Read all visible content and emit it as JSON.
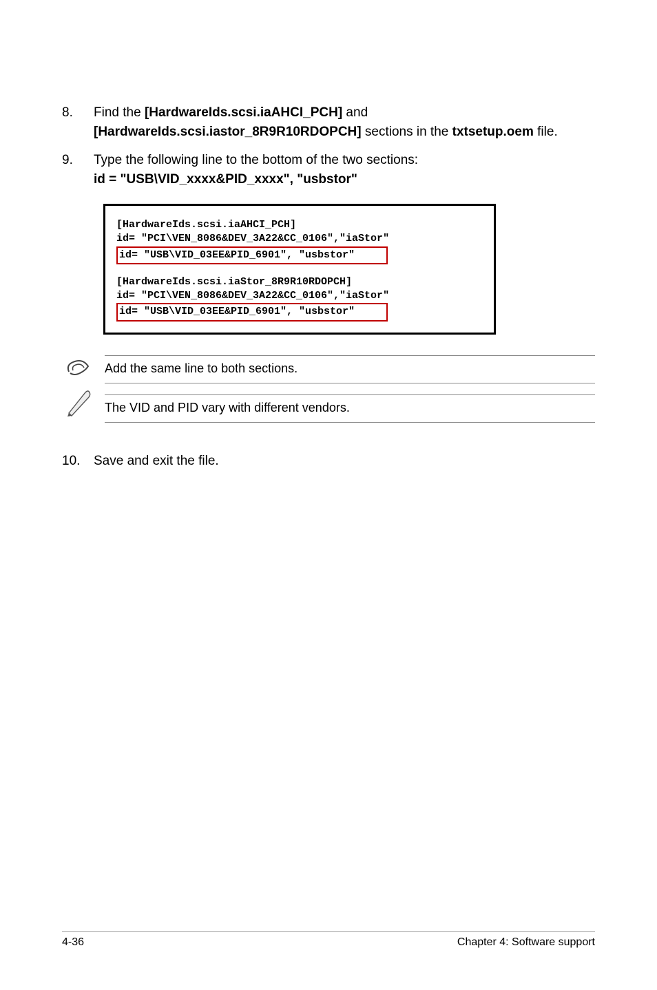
{
  "steps": {
    "s8": {
      "num": "8.",
      "t1": "Find the ",
      "b1": "[HardwareIds.scsi.iaAHCI_PCH]",
      "t2": " and ",
      "b2": "[HardwareIds.scsi.iastor_8R9R10RDOPCH]",
      "t3": " sections in the ",
      "b3": "txtsetup.oem",
      "t4": " file."
    },
    "s9": {
      "num": "9.",
      "t1": "Type the following line to the bottom of the two sections:",
      "b1": "id = \"USB\\VID_xxxx&PID_xxxx\", \"usbstor\""
    },
    "s10": {
      "num": "10.",
      "t1": "Save and exit the file."
    }
  },
  "code": {
    "g1l1": "[HardwareIds.scsi.iaAHCI_PCH]",
    "g1l2": "id= \"PCI\\VEN_8086&DEV_3A22&CC_0106\",\"iaStor\"",
    "g1l3": "id= \"USB\\VID_03EE&PID_6901\", \"usbstor\"",
    "g2l1": "[HardwareIds.scsi.iaStor_8R9R10RDOPCH]",
    "g2l2": "id= \"PCI\\VEN_8086&DEV_3A22&CC_0106\",\"iaStor\"",
    "g2l3": "id= \"USB\\VID_03EE&PID_6901\", \"usbstor\""
  },
  "notes": {
    "n1": "Add the same line to both sections.",
    "n2": "The VID and PID vary with different vendors."
  },
  "footer": {
    "left": "4-36",
    "right": "Chapter 4: Software support"
  }
}
